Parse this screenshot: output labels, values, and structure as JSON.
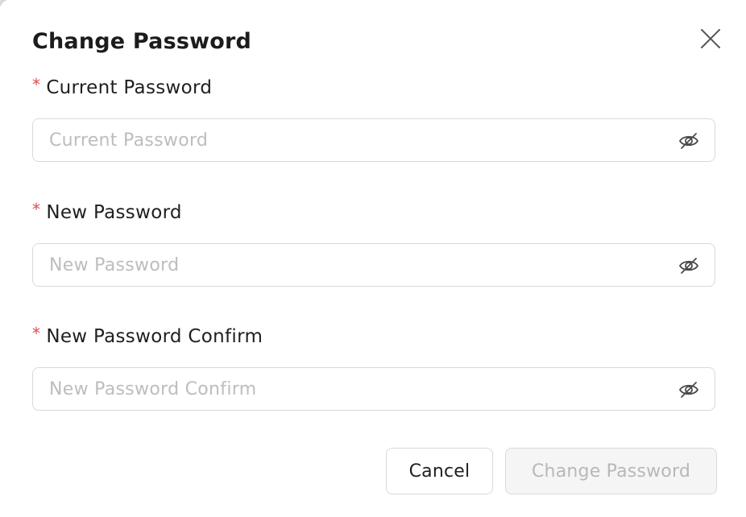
{
  "dialog": {
    "title": "Change Password",
    "close_icon": "close-icon"
  },
  "fields": [
    {
      "label": "Current Password",
      "required_mark": "*",
      "placeholder": "Current Password",
      "value": "",
      "toggle_icon": "eye-off-icon"
    },
    {
      "label": "New Password",
      "required_mark": "*",
      "placeholder": "New Password",
      "value": "",
      "toggle_icon": "eye-off-icon"
    },
    {
      "label": "New Password Confirm",
      "required_mark": "*",
      "placeholder": "New Password Confirm",
      "value": "",
      "toggle_icon": "eye-off-icon"
    }
  ],
  "actions": {
    "cancel_label": "Cancel",
    "submit_label": "Change Password",
    "submit_disabled": true
  },
  "colors": {
    "required": "#e5484d",
    "border": "#d9d9d9",
    "placeholder": "#bdbdbd",
    "disabled_bg": "#f5f5f5",
    "disabled_text": "#b8b8b8"
  }
}
